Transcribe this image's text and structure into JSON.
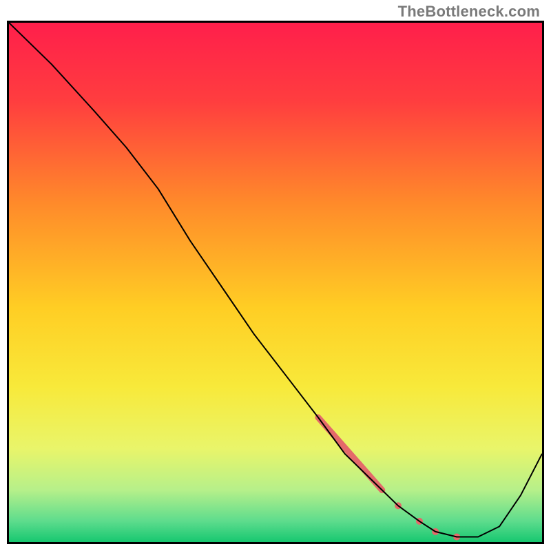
{
  "watermark": "TheBottleneck.com",
  "chart_data": {
    "type": "line",
    "title": "",
    "xlabel": "",
    "ylabel": "",
    "xlim": [
      0,
      100
    ],
    "ylim": [
      0,
      100
    ],
    "background": {
      "type": "vertical-gradient",
      "stops": [
        {
          "offset": 0.0,
          "color": "#ff1f4b"
        },
        {
          "offset": 0.15,
          "color": "#ff3d3f"
        },
        {
          "offset": 0.35,
          "color": "#ff8b2a"
        },
        {
          "offset": 0.55,
          "color": "#ffce24"
        },
        {
          "offset": 0.7,
          "color": "#f8e93a"
        },
        {
          "offset": 0.82,
          "color": "#e9f56a"
        },
        {
          "offset": 0.9,
          "color": "#b6f08a"
        },
        {
          "offset": 0.96,
          "color": "#5ddc8d"
        },
        {
          "offset": 1.0,
          "color": "#17c770"
        }
      ]
    },
    "series": [
      {
        "name": "bottleneck-curve",
        "x": [
          0,
          8,
          16,
          22,
          28,
          34,
          40,
          46,
          52,
          58,
          63,
          68,
          73,
          77,
          80,
          84,
          88,
          92,
          96,
          100
        ],
        "y": [
          100,
          92,
          83,
          76,
          68,
          58,
          49,
          40,
          32,
          24,
          17,
          12,
          7,
          4,
          2,
          1,
          1,
          3,
          9,
          17
        ],
        "stroke": "#000000",
        "width": 2
      }
    ],
    "markers": [
      {
        "name": "highlight-segment",
        "type": "thick-line",
        "x0": 58,
        "y0": 24,
        "x1": 70,
        "y1": 10,
        "color": "#e46a6a",
        "width": 9,
        "cap": "round"
      },
      {
        "name": "dot-1",
        "type": "dot",
        "x": 73,
        "y": 7,
        "r": 5,
        "color": "#e46a6a"
      },
      {
        "name": "dot-2",
        "type": "dot",
        "x": 77,
        "y": 4,
        "r": 5,
        "color": "#e46a6a"
      },
      {
        "name": "dot-3",
        "type": "dot",
        "x": 80,
        "y": 2,
        "r": 5,
        "color": "#e46a6a"
      },
      {
        "name": "dot-4",
        "type": "dot",
        "x": 84,
        "y": 1,
        "r": 5,
        "color": "#e46a6a"
      }
    ]
  }
}
